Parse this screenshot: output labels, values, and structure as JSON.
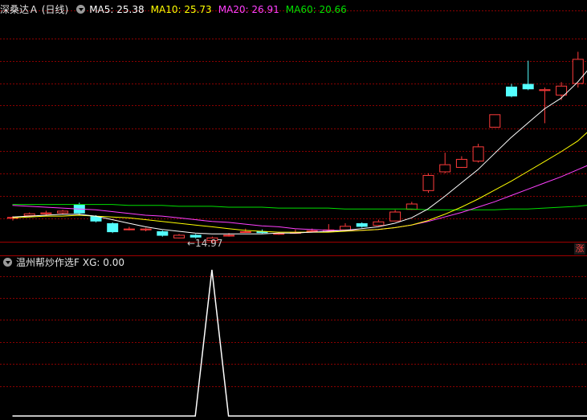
{
  "main_panel": {
    "title": "深桑达Ａ (日线)",
    "indicators": [
      {
        "label": "MA5:",
        "value": "25.38",
        "color": "#ffffff"
      },
      {
        "label": "MA10:",
        "value": "25.73",
        "color": "#ffff00"
      },
      {
        "label": "MA20:",
        "value": "26.91",
        "color": "#ff40ff"
      },
      {
        "label": "MA60:",
        "value": "20.66",
        "color": "#00e000"
      }
    ],
    "low_marker": "←14.97",
    "side_badge": "涨"
  },
  "sub_panel": {
    "title": "温州帮炒作选F",
    "indicator_label": "XG:",
    "indicator_value": "0.00"
  },
  "colors": {
    "background": "#000000",
    "grid": "#8b0000",
    "up_candle": "#ff3b3b",
    "down_candle": "#54ffff",
    "ma5": "#ffffff",
    "ma10": "#ffff00",
    "ma20": "#ff40ff",
    "ma60": "#00e000",
    "xg": "#ffffff"
  },
  "chart_data": {
    "type": "candlestick",
    "candles": [
      {
        "o": 15.4,
        "h": 15.6,
        "l": 15.1,
        "c": 15.5
      },
      {
        "o": 15.7,
        "h": 16.0,
        "l": 15.5,
        "c": 15.9
      },
      {
        "o": 15.9,
        "h": 16.2,
        "l": 15.7,
        "c": 16.0
      },
      {
        "o": 16.0,
        "h": 16.3,
        "l": 15.8,
        "c": 16.2
      },
      {
        "o": 16.9,
        "h": 17.1,
        "l": 15.8,
        "c": 15.9
      },
      {
        "o": 15.6,
        "h": 15.7,
        "l": 14.9,
        "c": 15.0
      },
      {
        "o": 14.8,
        "h": 14.9,
        "l": 13.7,
        "c": 13.8
      },
      {
        "o": 14.2,
        "h": 14.4,
        "l": 14.0,
        "c": 14.2
      },
      {
        "o": 14.1,
        "h": 14.3,
        "l": 13.9,
        "c": 14.2
      },
      {
        "o": 13.9,
        "h": 14.0,
        "l": 13.3,
        "c": 13.4
      },
      {
        "o": 13.2,
        "h": 13.6,
        "l": 13.1,
        "c": 13.5
      },
      {
        "o": 13.5,
        "h": 13.6,
        "l": 13.1,
        "c": 13.2
      },
      {
        "o": 12.9,
        "h": 13.3,
        "l": 12.6,
        "c": 13.2
      },
      {
        "o": 13.5,
        "h": 13.7,
        "l": 13.3,
        "c": 13.5
      },
      {
        "o": 13.9,
        "h": 14.2,
        "l": 13.8,
        "c": 13.9
      },
      {
        "o": 13.9,
        "h": 14.1,
        "l": 13.6,
        "c": 13.7
      },
      {
        "o": 13.7,
        "h": 13.8,
        "l": 13.5,
        "c": 13.7
      },
      {
        "o": 13.8,
        "h": 14.1,
        "l": 13.7,
        "c": 13.8
      },
      {
        "o": 14.0,
        "h": 14.2,
        "l": 13.9,
        "c": 14.0
      },
      {
        "o": 13.9,
        "h": 14.7,
        "l": 13.8,
        "c": 14.1
      },
      {
        "o": 14.1,
        "h": 14.8,
        "l": 14.0,
        "c": 14.5
      },
      {
        "o": 14.8,
        "h": 14.9,
        "l": 14.3,
        "c": 14.4
      },
      {
        "o": 14.6,
        "h": 15.2,
        "l": 14.5,
        "c": 15.0
      },
      {
        "o": 15.1,
        "h": 16.3,
        "l": 15.0,
        "c": 16.1
      },
      {
        "o": 16.4,
        "h": 17.2,
        "l": 16.3,
        "c": 17.0
      },
      {
        "o": 18.5,
        "h": 20.4,
        "l": 18.2,
        "c": 20.2
      },
      {
        "o": 20.6,
        "h": 22.7,
        "l": 20.4,
        "c": 21.4
      },
      {
        "o": 21.1,
        "h": 22.3,
        "l": 21.0,
        "c": 22.0
      },
      {
        "o": 21.8,
        "h": 23.7,
        "l": 21.6,
        "c": 23.4
      },
      {
        "o": 25.6,
        "h": 27.0,
        "l": 25.5,
        "c": 27.0
      },
      {
        "o": 30.1,
        "h": 30.4,
        "l": 28.9,
        "c": 29.0
      },
      {
        "o": 30.4,
        "h": 33.0,
        "l": 29.7,
        "c": 29.8
      },
      {
        "o": 29.7,
        "h": 30.0,
        "l": 26.0,
        "c": 29.8
      },
      {
        "o": 29.2,
        "h": 30.6,
        "l": 28.6,
        "c": 30.2
      },
      {
        "o": 30.5,
        "h": 34.0,
        "l": 30.0,
        "c": 33.2
      },
      {
        "o": 34.2,
        "h": 37.0,
        "l": 32.0,
        "c": 37.0
      }
    ],
    "ma5": [
      15.5,
      15.6,
      15.7,
      15.8,
      15.8,
      15.6,
      15.2,
      14.8,
      14.4,
      14.1,
      13.9,
      13.7,
      13.6,
      13.6,
      13.6,
      13.6,
      13.7,
      13.7,
      13.8,
      13.9,
      14.0,
      14.2,
      14.4,
      14.8,
      15.4,
      16.4,
      17.8,
      19.3,
      20.8,
      22.6,
      24.4,
      26.0,
      27.6,
      28.8,
      30.6,
      32.8
    ],
    "ma10": [
      15.4,
      15.5,
      15.6,
      15.6,
      15.7,
      15.6,
      15.5,
      15.4,
      15.2,
      15.0,
      14.8,
      14.6,
      14.4,
      14.2,
      14.0,
      13.9,
      13.8,
      13.8,
      13.8,
      13.8,
      13.9,
      14.0,
      14.1,
      14.3,
      14.6,
      15.1,
      15.8,
      16.6,
      17.5,
      18.5,
      19.5,
      20.6,
      21.7,
      22.8,
      24.0,
      25.7
    ],
    "ma20": [
      16.8,
      16.7,
      16.6,
      16.5,
      16.4,
      16.3,
      16.1,
      15.9,
      15.7,
      15.6,
      15.4,
      15.2,
      15.0,
      14.9,
      14.7,
      14.5,
      14.4,
      14.2,
      14.1,
      14.0,
      14.0,
      14.0,
      14.1,
      14.3,
      14.6,
      15.0,
      15.5,
      16.0,
      16.6,
      17.2,
      17.9,
      18.6,
      19.3,
      20.0,
      20.8,
      21.6
    ],
    "ma60": [
      16.9,
      16.9,
      16.9,
      16.9,
      16.9,
      16.9,
      16.9,
      16.8,
      16.8,
      16.8,
      16.7,
      16.7,
      16.7,
      16.6,
      16.6,
      16.6,
      16.5,
      16.5,
      16.5,
      16.5,
      16.4,
      16.4,
      16.4,
      16.4,
      16.4,
      16.3,
      16.3,
      16.3,
      16.3,
      16.3,
      16.4,
      16.4,
      16.5,
      16.6,
      16.7,
      16.9
    ],
    "y_range": [
      13.0,
      38.0
    ],
    "xg": [
      0,
      0,
      0,
      0,
      0,
      0,
      0,
      0,
      0,
      0,
      0,
      0,
      1,
      0,
      0,
      0,
      0,
      0,
      0,
      0,
      0,
      0,
      0,
      0,
      0,
      0,
      0,
      0,
      0,
      0,
      0,
      0,
      0,
      0,
      0,
      0
    ],
    "xg_range": [
      0,
      1
    ]
  }
}
